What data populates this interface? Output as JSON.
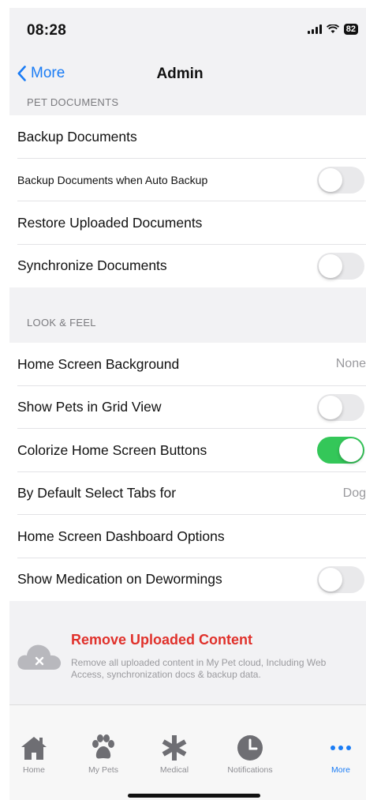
{
  "status_bar": {
    "time": "08:28",
    "battery": "82"
  },
  "nav": {
    "back_label": "More",
    "title": "Admin"
  },
  "pet_documents": {
    "header": "PET DOCUMENTS",
    "rows": [
      {
        "label": "Backup Documents"
      },
      {
        "label": "Backup Documents when Auto Backup",
        "toggle": false
      },
      {
        "label": "Restore Uploaded Documents"
      },
      {
        "label": "Synchronize Documents",
        "toggle": false
      }
    ]
  },
  "look_feel": {
    "header": "LOOK & FEEL",
    "rows": [
      {
        "label": "Home Screen Background",
        "value": "None"
      },
      {
        "label": "Show Pets in Grid View",
        "toggle": false
      },
      {
        "label": "Colorize Home Screen Buttons",
        "toggle": true
      },
      {
        "label": "By Default Select Tabs for",
        "value": "Dog"
      },
      {
        "label": "Home Screen Dashboard Options"
      },
      {
        "label": "Show Medication on Dewormings",
        "toggle": false
      }
    ]
  },
  "remove": {
    "title": "Remove Uploaded Content",
    "description": "Remove all uploaded content in My Pet cloud, Including Web Access, synchronization docs & backup data."
  },
  "tabbar": {
    "tabs": [
      {
        "label": "Home",
        "icon": "house-icon"
      },
      {
        "label": "My Pets",
        "icon": "paw-icon"
      },
      {
        "label": "Medical",
        "icon": "asterisk-icon"
      },
      {
        "label": "Notifications",
        "icon": "clock-icon"
      },
      {
        "label": "More",
        "icon": "ellipsis-icon",
        "active": true
      }
    ]
  },
  "colors": {
    "accent": "#1a7cf5",
    "toggle_on": "#34c759",
    "destructive": "#e0312b"
  }
}
